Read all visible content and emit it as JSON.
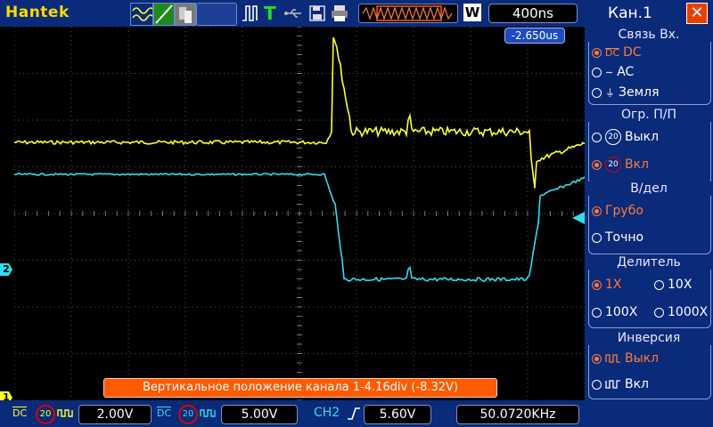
{
  "header": {
    "brand": "Hantek",
    "mode_t": "T",
    "w_label": "W",
    "timebase": "400ns"
  },
  "trigger_delay": "-2.650us",
  "markers": {
    "ch1": "1",
    "ch2": "2"
  },
  "message": "Вертикальное положение канала 1-4.16div (-8.32V)",
  "bottom": {
    "ch1_coupling": "DC",
    "ch1_bw": "20",
    "ch1_scale": "2.00V",
    "ch2_coupling": "DC",
    "ch2_bw": "20",
    "ch2_scale": "5.00V",
    "trig_source": "CH2",
    "trig_level": "5.60V",
    "frequency": "50.0720KHz"
  },
  "panel": {
    "title": "Кан.1",
    "coupling": {
      "header": "Связь Вх.",
      "options": [
        "DC",
        "AC",
        "Земля"
      ],
      "selected": 0
    },
    "bw_limit": {
      "header": "Огр. П/П",
      "options": [
        "Выкл",
        "Вкл"
      ],
      "selected": 1
    },
    "volts_div": {
      "header": "В/дел",
      "options": [
        "Грубо",
        "Точно"
      ],
      "selected": 0
    },
    "probe": {
      "header": "Делитель",
      "options": [
        "1X",
        "10X",
        "100X",
        "1000X"
      ],
      "selected": 0
    },
    "invert": {
      "header": "Инверсия",
      "options": [
        "Выкл",
        "Вкл"
      ],
      "selected": 0
    }
  },
  "colors": {
    "ch1": "#ffff33",
    "ch2": "#33ddee",
    "panel_bg": "#0a2a7a",
    "selected": "#ff7a3a",
    "message_bg": "#ff5a00"
  }
}
